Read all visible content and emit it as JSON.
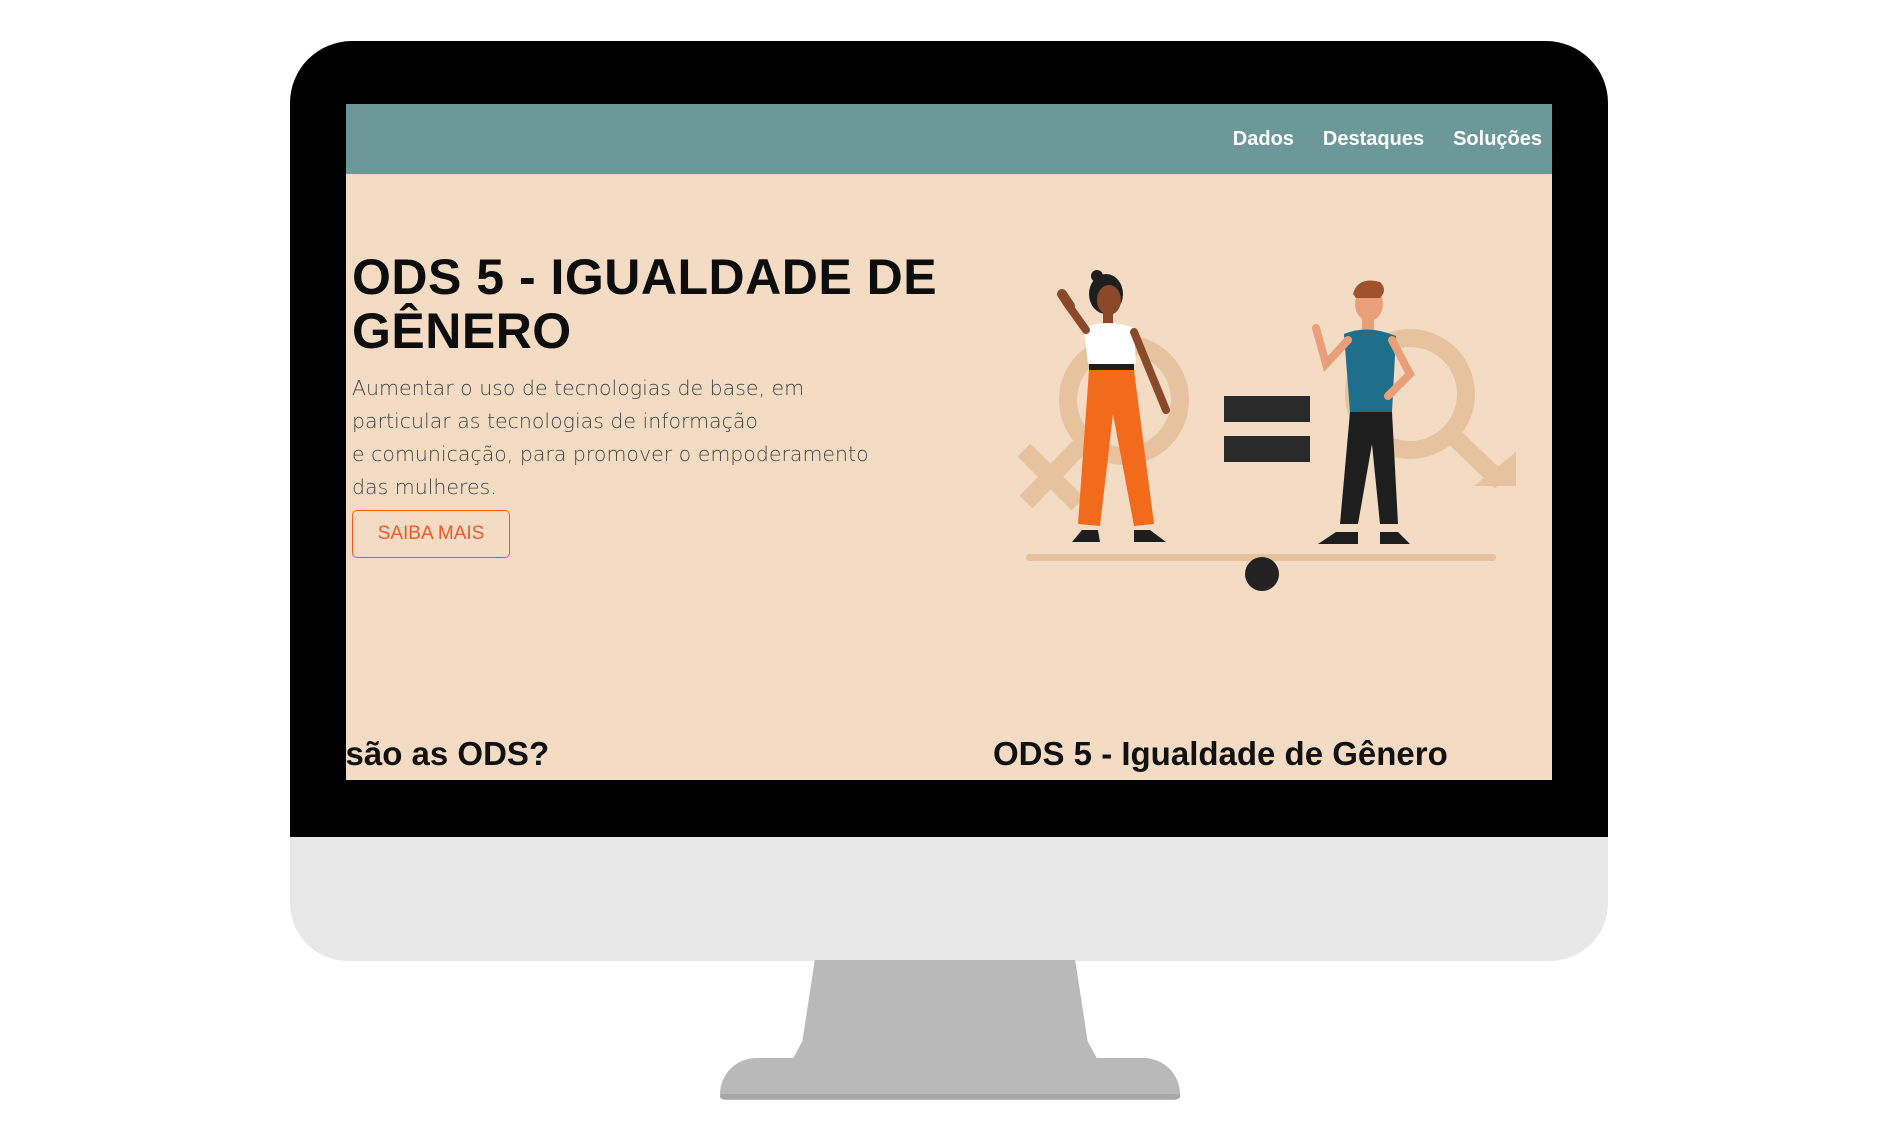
{
  "nav": {
    "items": [
      "Dados",
      "Destaques",
      "Soluções"
    ]
  },
  "hero": {
    "title_line1": "ODS 5 - IGUALDADE DE",
    "title_line2": "GÊNERO",
    "text_lines": [
      "Aumentar o uso de tecnologias de base, em",
      "particular as tecnologias de informação",
      "e comunicação, para promover o empoderamento",
      "das mulheres."
    ],
    "button_label": "SAIBA MAIS"
  },
  "sections": {
    "left_heading": "e são as ODS?",
    "right_heading": "ODS 5 - Igualdade de Gênero"
  },
  "colors": {
    "navbar": "#6d989a",
    "page_background": "#f4dcc4",
    "accent": "#ef5a2a"
  }
}
